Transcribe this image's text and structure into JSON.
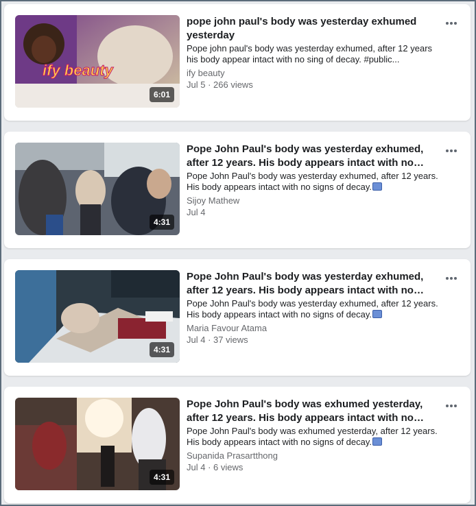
{
  "videos": [
    {
      "title": "pope john paul's body was yesterday exhumed yesterday",
      "description": "Pope john paul's body was yesterday exhumed, after 12 years his body appear intact with no sing of decay. #public...",
      "channel": "ify beauty",
      "meta": "Jul 5 · 266 views",
      "duration": "6:01",
      "thumb_overlay_text": "ify beauty"
    },
    {
      "title": "Pope John Paul's body was yesterday exhumed, after 12 years. His body appears intact with no signs of...",
      "description": "Pope John Paul's body was yesterday exhumed, after 12 years. His body appears intact with no signs of decay.",
      "channel": "Sijoy Mathew",
      "meta": "Jul 4",
      "duration": "4:31"
    },
    {
      "title": "Pope John Paul's body was yesterday exhumed, after 12 years. His body appears intact with no signs of...",
      "description": "Pope John Paul's body was yesterday exhumed, after 12 years. His body appears intact with no signs of decay.",
      "channel": "Maria Favour Atama",
      "meta": "Jul 4 · 37 views",
      "duration": "4:31"
    },
    {
      "title": "Pope John Paul's body was exhumed yesterday, after 12 years. His body appears intact with no signs of...",
      "description": "Pope John Paul's body was exhumed yesterday, after 12 years. His body appears intact with no signs of decay.",
      "channel": "Supanida Prasartthong",
      "meta": "Jul 4 · 6 views",
      "duration": "4:31"
    }
  ],
  "icons": {
    "more": "more-horizontal-icon",
    "emoji": "framed-picture-emoji-icon"
  },
  "colors": {
    "card_bg": "#ffffff",
    "page_bg": "#e9ebee",
    "secondary_text": "#65676b",
    "primary_text": "#1c1e21"
  }
}
